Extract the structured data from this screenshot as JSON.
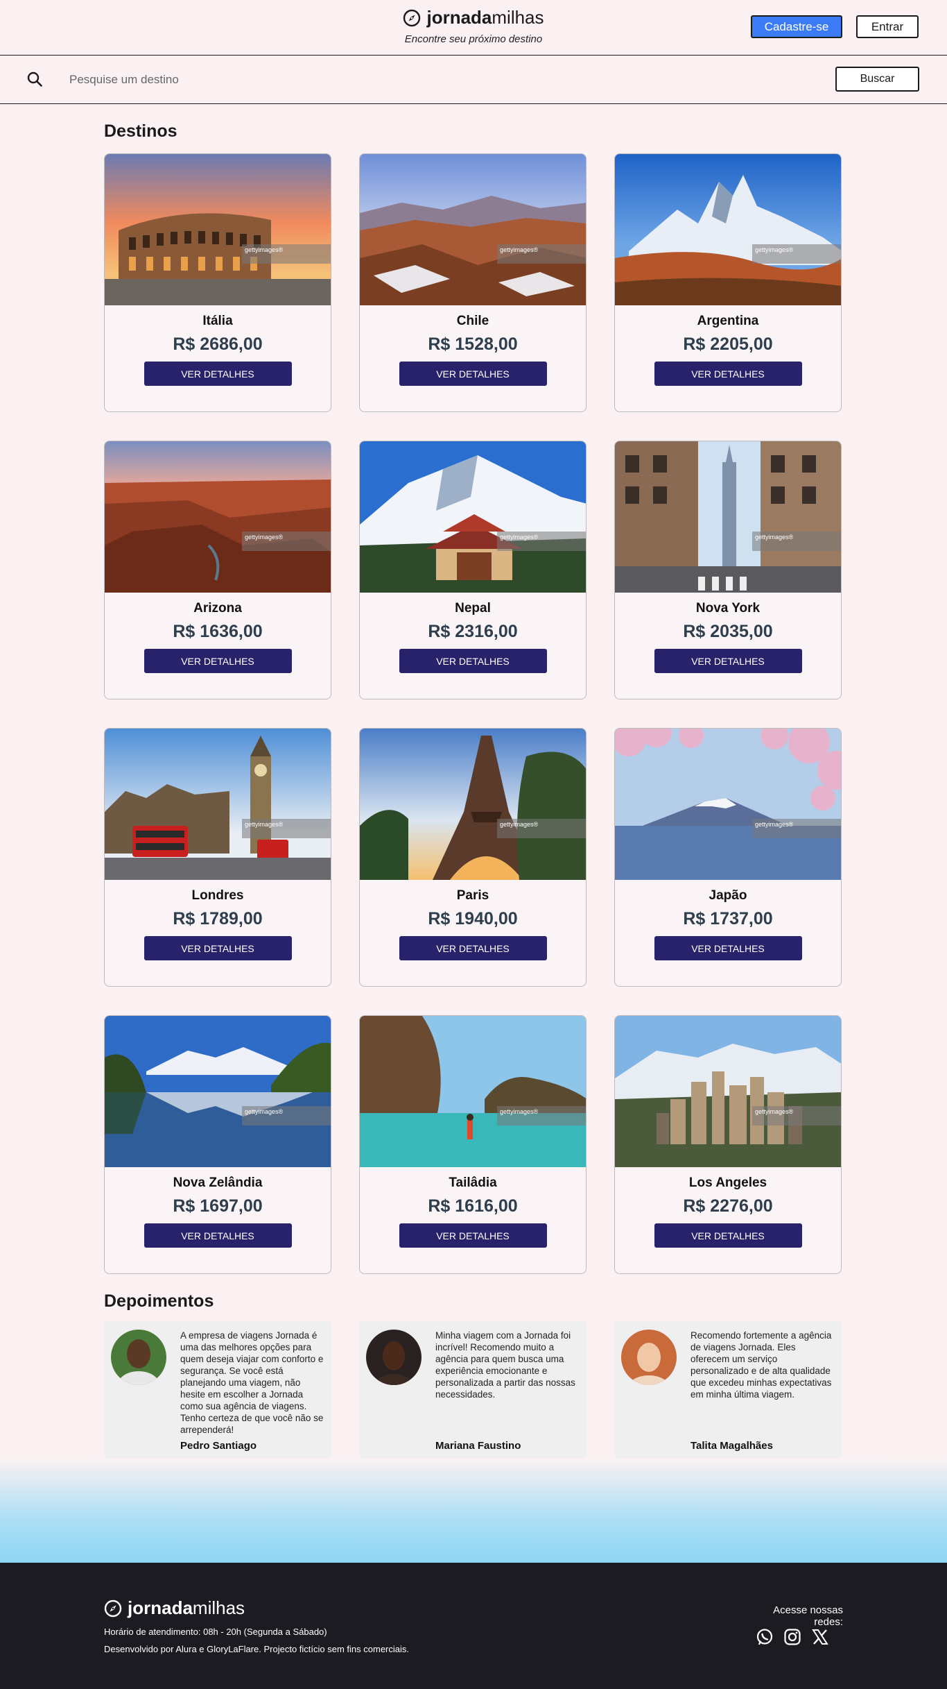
{
  "header": {
    "brand_bold": "jornada",
    "brand_light": "milhas",
    "tagline": "Encontre seu próximo destino",
    "signup_label": "Cadastre-se",
    "login_label": "Entrar"
  },
  "search": {
    "placeholder": "Pesquise um destino",
    "button_label": "Buscar"
  },
  "destinations": {
    "title": "Destinos",
    "details_label": "VER DETALHES",
    "items": [
      {
        "name": "Itália",
        "price": "R$ 2686,00"
      },
      {
        "name": "Chile",
        "price": "R$ 1528,00"
      },
      {
        "name": "Argentina",
        "price": "R$ 2205,00"
      },
      {
        "name": "Arizona",
        "price": "R$ 1636,00"
      },
      {
        "name": "Nepal",
        "price": "R$ 2316,00"
      },
      {
        "name": "Nova York",
        "price": "R$ 2035,00"
      },
      {
        "name": "Londres",
        "price": "R$ 1789,00"
      },
      {
        "name": "Paris",
        "price": "R$ 1940,00"
      },
      {
        "name": "Japão",
        "price": "R$ 1737,00"
      },
      {
        "name": "Nova Zelândia",
        "price": "R$ 1697,00"
      },
      {
        "name": "Tailâdia",
        "price": "R$ 1616,00"
      },
      {
        "name": "Los Angeles",
        "price": "R$ 2276,00"
      }
    ]
  },
  "testimonials": {
    "title": "Depoimentos",
    "items": [
      {
        "text": "A empresa de viagens Jornada é uma das melhores opções para quem deseja viajar com conforto e segurança. Se você está planejando uma viagem, não hesite em escolher a Jornada como sua agência de viagens. Tenho certeza de que você não se arrependerá!",
        "author": "Pedro Santiago"
      },
      {
        "text": "Minha viagem com a Jornada foi incrível! Recomendo muito a agência para quem busca uma experiência emocionante e personalizada a partir das nossas necessidades.",
        "author": "Mariana Faustino"
      },
      {
        "text": "Recomendo fortemente a agência de viagens Jornada. Eles oferecem um serviço personalizado e de alta qualidade que excedeu minhas expectativas em minha última viagem.",
        "author": "Talita Magalhães"
      }
    ]
  },
  "footer": {
    "brand_bold": "jornada",
    "brand_light": "milhas",
    "hours": "Horário de atendimento: 08h - 20h (Segunda a Sábado)",
    "credits": "Desenvolvido por Alura e GloryLaFlare. Projecto fictício sem fins comerciais.",
    "social_label": "Acesse nossas redes:",
    "social_icons": [
      "whatsapp-icon",
      "instagram-icon",
      "x-icon"
    ]
  },
  "colors": {
    "signup": "#3b7cf6",
    "details_button": "#28226b",
    "price": "#2f3e4d",
    "footer_bg": "#1d1b22"
  }
}
